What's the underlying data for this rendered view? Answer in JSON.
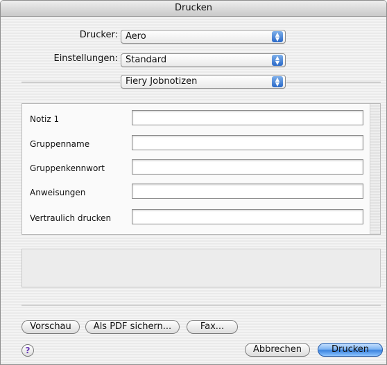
{
  "window": {
    "title": "Drucken"
  },
  "printer": {
    "label": "Drucker:",
    "value": "Aero"
  },
  "presets": {
    "label": "Einstellungen:",
    "value": "Standard"
  },
  "section": {
    "value": "Fiery Jobnotizen"
  },
  "fields": [
    {
      "label": "Notiz 1",
      "value": ""
    },
    {
      "label": "Gruppenname",
      "value": ""
    },
    {
      "label": "Gruppenkennwort",
      "value": ""
    },
    {
      "label": "Anweisungen",
      "value": ""
    },
    {
      "label": "Vertraulich drucken",
      "value": ""
    }
  ],
  "buttons": {
    "preview": "Vorschau",
    "save_pdf": "Als PDF sichern...",
    "fax": "Fax...",
    "cancel": "Abbrechen",
    "print": "Drucken",
    "help": "?"
  },
  "icons": {
    "popup_arrows": "up-down-arrows-icon",
    "help": "help-icon"
  },
  "colors": {
    "default_button": "#3b84df",
    "popup_arrow": "#2a69c8"
  }
}
